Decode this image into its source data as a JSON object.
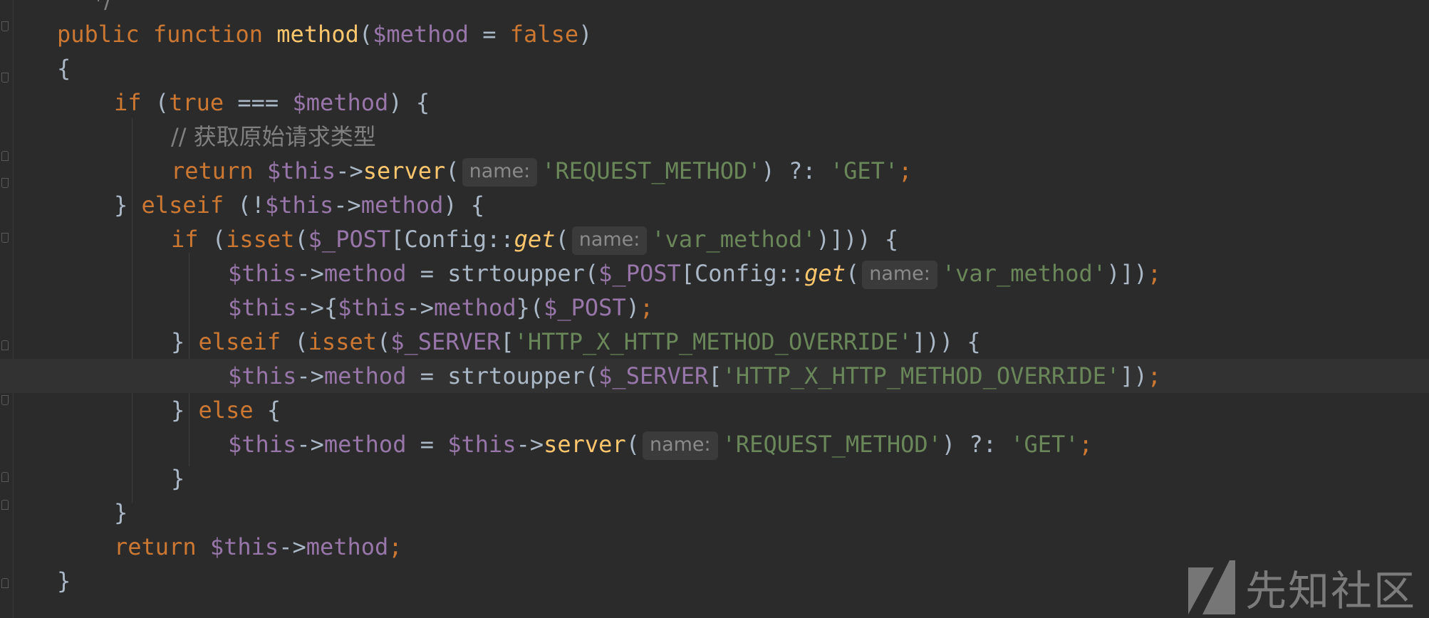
{
  "editor": {
    "lines": [
      {
        "indent": 0,
        "current": false,
        "tokens": [
          {
            "t": " */",
            "c": "cmt"
          }
        ]
      },
      {
        "indent": 1,
        "current": false,
        "tokens": [
          {
            "t": "public ",
            "c": "kw"
          },
          {
            "t": "function ",
            "c": "kw"
          },
          {
            "t": "method",
            "c": "fn"
          },
          {
            "t": "(",
            "c": "pl"
          },
          {
            "t": "$method",
            "c": "var"
          },
          {
            "t": " = ",
            "c": "pl"
          },
          {
            "t": "false",
            "c": "kw"
          },
          {
            "t": ")",
            "c": "pl"
          }
        ]
      },
      {
        "indent": 1,
        "current": false,
        "tokens": [
          {
            "t": "{",
            "c": "pl"
          }
        ]
      },
      {
        "indent": 2,
        "current": false,
        "tokens": [
          {
            "t": "if ",
            "c": "kw"
          },
          {
            "t": "(",
            "c": "pl"
          },
          {
            "t": "true",
            "c": "kw"
          },
          {
            "t": " === ",
            "c": "pl"
          },
          {
            "t": "$method",
            "c": "var"
          },
          {
            "t": ") {",
            "c": "pl"
          }
        ]
      },
      {
        "indent": 3,
        "current": false,
        "tokens": [
          {
            "t": "// 获取原始请求类型",
            "c": "cmt"
          }
        ]
      },
      {
        "indent": 3,
        "current": false,
        "tokens": [
          {
            "t": "return ",
            "c": "kw"
          },
          {
            "t": "$this",
            "c": "var"
          },
          {
            "t": "->",
            "c": "pl"
          },
          {
            "t": "server",
            "c": "fn"
          },
          {
            "t": "(",
            "c": "pl"
          },
          {
            "hint": "name:"
          },
          {
            "t": "'REQUEST_METHOD'",
            "c": "str"
          },
          {
            "t": ") ?: ",
            "c": "pl"
          },
          {
            "t": "'GET'",
            "c": "str"
          },
          {
            "t": ";",
            "c": "semi"
          }
        ]
      },
      {
        "indent": 2,
        "current": false,
        "tokens": [
          {
            "t": "} ",
            "c": "pl"
          },
          {
            "t": "elseif ",
            "c": "kw"
          },
          {
            "t": "(!",
            "c": "pl"
          },
          {
            "t": "$this",
            "c": "var"
          },
          {
            "t": "->",
            "c": "pl"
          },
          {
            "t": "method",
            "c": "var"
          },
          {
            "t": ") {",
            "c": "pl"
          }
        ]
      },
      {
        "indent": 3,
        "current": false,
        "tokens": [
          {
            "t": "if ",
            "c": "kw"
          },
          {
            "t": "(",
            "c": "pl"
          },
          {
            "t": "isset",
            "c": "kw"
          },
          {
            "t": "(",
            "c": "pl"
          },
          {
            "t": "$_POST",
            "c": "var"
          },
          {
            "t": "[Config::",
            "c": "pl"
          },
          {
            "t": "get",
            "c": "it"
          },
          {
            "t": "(",
            "c": "pl"
          },
          {
            "hint": "name:"
          },
          {
            "t": "'var_method'",
            "c": "str"
          },
          {
            "t": ")])) {",
            "c": "pl"
          }
        ]
      },
      {
        "indent": 4,
        "current": false,
        "tokens": [
          {
            "t": "$this",
            "c": "var"
          },
          {
            "t": "->",
            "c": "pl"
          },
          {
            "t": "method",
            "c": "var"
          },
          {
            "t": " = strtoupper(",
            "c": "pl"
          },
          {
            "t": "$_POST",
            "c": "var"
          },
          {
            "t": "[Config::",
            "c": "pl"
          },
          {
            "t": "get",
            "c": "it"
          },
          {
            "t": "(",
            "c": "pl"
          },
          {
            "hint": "name:"
          },
          {
            "t": "'var_method'",
            "c": "str"
          },
          {
            "t": ")])",
            "c": "pl"
          },
          {
            "t": ";",
            "c": "semi"
          }
        ]
      },
      {
        "indent": 4,
        "current": false,
        "tokens": [
          {
            "t": "$this",
            "c": "var"
          },
          {
            "t": "->{",
            "c": "pl"
          },
          {
            "t": "$this",
            "c": "var"
          },
          {
            "t": "->",
            "c": "pl"
          },
          {
            "t": "method",
            "c": "var"
          },
          {
            "t": "}(",
            "c": "pl"
          },
          {
            "t": "$_POST",
            "c": "var"
          },
          {
            "t": ")",
            "c": "pl"
          },
          {
            "t": ";",
            "c": "semi"
          }
        ]
      },
      {
        "indent": 3,
        "current": false,
        "tokens": [
          {
            "t": "} ",
            "c": "pl"
          },
          {
            "t": "elseif ",
            "c": "kw"
          },
          {
            "t": "(",
            "c": "pl"
          },
          {
            "t": "isset",
            "c": "kw"
          },
          {
            "t": "(",
            "c": "pl"
          },
          {
            "t": "$_SERVER",
            "c": "var"
          },
          {
            "t": "[",
            "c": "pl"
          },
          {
            "t": "'HTTP_X_HTTP_METHOD_OVERRIDE'",
            "c": "str"
          },
          {
            "t": "])) {",
            "c": "pl"
          }
        ]
      },
      {
        "indent": 4,
        "current": true,
        "tokens": [
          {
            "t": "$this",
            "c": "var"
          },
          {
            "t": "->",
            "c": "pl"
          },
          {
            "t": "method",
            "c": "var"
          },
          {
            "t": " = strtoupper(",
            "c": "pl"
          },
          {
            "t": "$_SERVER",
            "c": "var"
          },
          {
            "t": "[",
            "c": "pl"
          },
          {
            "t": "'HTTP_X_HTTP_METHOD_OVERRIDE'",
            "c": "str"
          },
          {
            "t": "])",
            "c": "pl"
          },
          {
            "t": ";",
            "c": "semi"
          }
        ]
      },
      {
        "indent": 3,
        "current": false,
        "tokens": [
          {
            "t": "} ",
            "c": "pl"
          },
          {
            "t": "else ",
            "c": "kw"
          },
          {
            "t": "{",
            "c": "pl"
          }
        ]
      },
      {
        "indent": 4,
        "current": false,
        "tokens": [
          {
            "t": "$this",
            "c": "var"
          },
          {
            "t": "->",
            "c": "pl"
          },
          {
            "t": "method",
            "c": "var"
          },
          {
            "t": " = ",
            "c": "pl"
          },
          {
            "t": "$this",
            "c": "var"
          },
          {
            "t": "->",
            "c": "pl"
          },
          {
            "t": "server",
            "c": "fn"
          },
          {
            "t": "(",
            "c": "pl"
          },
          {
            "hint": "name:"
          },
          {
            "t": "'REQUEST_METHOD'",
            "c": "str"
          },
          {
            "t": ") ?: ",
            "c": "pl"
          },
          {
            "t": "'GET'",
            "c": "str"
          },
          {
            "t": ";",
            "c": "semi"
          }
        ]
      },
      {
        "indent": 3,
        "current": false,
        "tokens": [
          {
            "t": "}",
            "c": "pl"
          }
        ]
      },
      {
        "indent": 2,
        "current": false,
        "tokens": [
          {
            "t": "}",
            "c": "pl"
          }
        ]
      },
      {
        "indent": 2,
        "current": false,
        "tokens": [
          {
            "t": "return ",
            "c": "kw"
          },
          {
            "t": "$this",
            "c": "var"
          },
          {
            "t": "->",
            "c": "pl"
          },
          {
            "t": "method",
            "c": "var"
          },
          {
            "t": ";",
            "c": "semi"
          }
        ]
      },
      {
        "indent": 1,
        "current": false,
        "tokens": [
          {
            "t": "}",
            "c": "pl"
          }
        ]
      }
    ]
  },
  "watermark": {
    "text": "先知社区",
    "logo_icon": "xianzhi-logo-icon"
  },
  "colors": {
    "background": "#2b2b2b",
    "keyword": "#cc7832",
    "function": "#ffc66d",
    "variable": "#9876aa",
    "string": "#6a8759",
    "comment": "#808080",
    "plain": "#a9b7c6"
  }
}
